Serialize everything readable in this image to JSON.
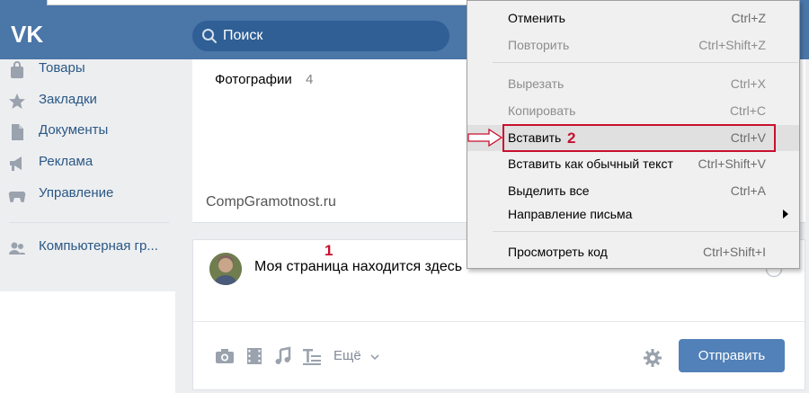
{
  "header": {
    "logo": "VK",
    "search": {
      "placeholder": "Поиск",
      "icon": "search-icon"
    }
  },
  "sidebar": {
    "items": [
      {
        "label": "Товары",
        "icon": "bag-icon"
      },
      {
        "label": "Закладки",
        "icon": "star-icon"
      },
      {
        "label": "Документы",
        "icon": "document-icon"
      },
      {
        "label": "Реклама",
        "icon": "megaphone-icon"
      },
      {
        "label": "Управление",
        "icon": "gamepad-icon"
      },
      {
        "label": "Компьютерная гр...",
        "icon": "group-icon"
      }
    ]
  },
  "photos": {
    "title": "Фотографии",
    "count": "4"
  },
  "watermark": "CompGramotnost.ru",
  "composer": {
    "text": "Моя страница находится здесь",
    "marker": "1",
    "more_label": "Ещё",
    "send_label": "Отправить",
    "tools": [
      "camera-icon",
      "film-icon",
      "music-icon",
      "text-format-icon"
    ]
  },
  "context_menu": {
    "items": [
      {
        "label": "Отменить",
        "shortcut": "Ctrl+Z",
        "disabled": false
      },
      {
        "label": "Повторить",
        "shortcut": "Ctrl+Shift+Z",
        "disabled": true
      },
      {
        "label": "Вырезать",
        "shortcut": "Ctrl+X",
        "disabled": true
      },
      {
        "label": "Копировать",
        "shortcut": "Ctrl+C",
        "disabled": true
      },
      {
        "label": "Вставить",
        "shortcut": "Ctrl+V",
        "disabled": false,
        "highlighted": true
      },
      {
        "label": "Вставить как обычный текст",
        "shortcut": "Ctrl+Shift+V",
        "disabled": false
      },
      {
        "label": "Выделить все",
        "shortcut": "Ctrl+A",
        "disabled": false
      },
      {
        "label": "Направление письма",
        "shortcut": "",
        "disabled": false,
        "submenu": true
      },
      {
        "label": "Просмотреть код",
        "shortcut": "Ctrl+Shift+I",
        "disabled": false
      }
    ],
    "marker": "2"
  },
  "colors": {
    "header": "#4a76a8",
    "link": "#2a5885",
    "button": "#5181b8",
    "annotation": "#c8102e",
    "page_bg": "#edeef0"
  }
}
